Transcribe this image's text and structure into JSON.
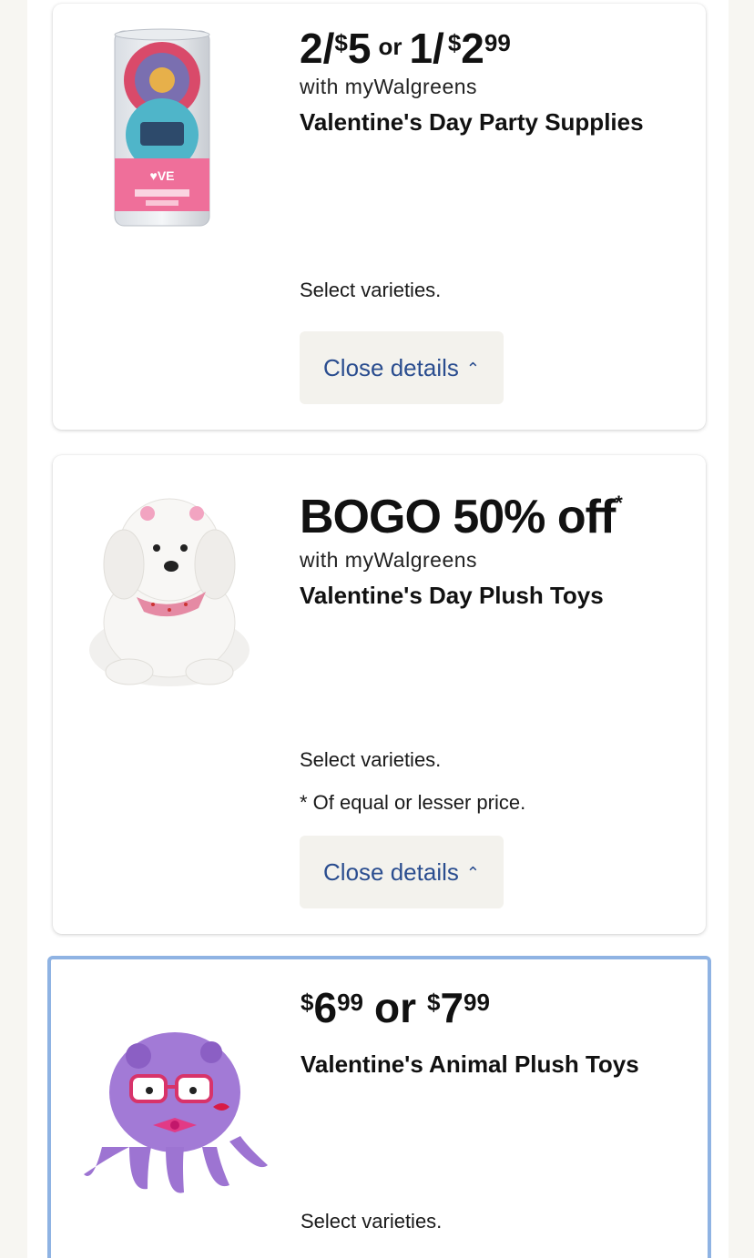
{
  "cards": [
    {
      "offer": {
        "multi_qty": "2/",
        "multi_dollar": "$",
        "multi_price": "5",
        "or": "or",
        "single_qty": "1/",
        "single_dollar": "$",
        "single_price": "2",
        "single_cents": "99"
      },
      "sub": "with myWalgreens",
      "title": "Valentine's Day Party Supplies",
      "notes": [
        "Select varieties."
      ],
      "button": "Close details",
      "image": "valentine-pinwheel-games-canister"
    },
    {
      "offer": {
        "text": "BOGO 50% off",
        "asterisk": "*"
      },
      "sub": "with myWalgreens",
      "title": "Valentine's Day Plush Toys",
      "notes": [
        "Select varieties.",
        "* Of equal or lesser price."
      ],
      "button": "Close details",
      "image": "white-plush-puppy"
    },
    {
      "offer": {
        "d1": "$",
        "p1": "6",
        "c1": "99",
        "or": "or",
        "d2": "$",
        "p2": "7",
        "c2": "99"
      },
      "title": "Valentine's Animal Plush Toys",
      "notes": [
        "Select varieties."
      ],
      "image": "purple-plush-octopus"
    }
  ],
  "icons": {
    "chevron": "chevron-up-icon"
  },
  "colors": {
    "button_text": "#2a4d8f",
    "button_bg": "#f3f2ed",
    "highlight_border": "#8fb3e3"
  }
}
